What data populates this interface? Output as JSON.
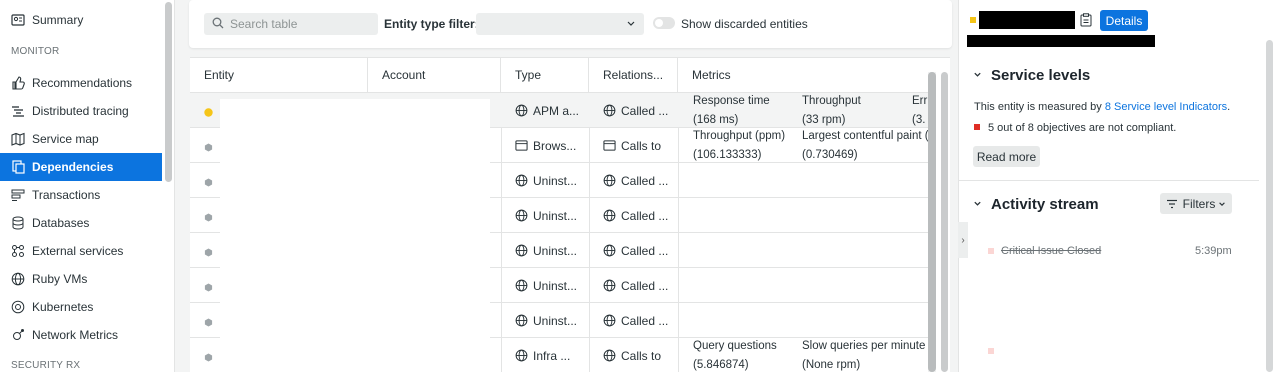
{
  "sidebar": {
    "top_item": {
      "label": "Summary",
      "icon": "summary-icon"
    },
    "sections": {
      "monitor": "MONITOR",
      "security": "SECURITY RX"
    },
    "items": [
      {
        "label": "Recommendations",
        "icon": "thumbs-up-icon"
      },
      {
        "label": "Distributed tracing",
        "icon": "tracing-icon"
      },
      {
        "label": "Service map",
        "icon": "map-icon"
      },
      {
        "label": "Dependencies",
        "icon": "dependencies-icon",
        "active": true
      },
      {
        "label": "Transactions",
        "icon": "transactions-icon"
      },
      {
        "label": "Databases",
        "icon": "database-icon"
      },
      {
        "label": "External services",
        "icon": "external-services-icon"
      },
      {
        "label": "Ruby VMs",
        "icon": "globe-icon"
      },
      {
        "label": "Kubernetes",
        "icon": "kubernetes-icon"
      },
      {
        "label": "Network Metrics",
        "icon": "network-icon"
      }
    ]
  },
  "toolbar": {
    "search_placeholder": "Search table",
    "filter_label": "Entity type filter:",
    "filter_value": "",
    "toggle_label": "Show discarded entities"
  },
  "table": {
    "columns": [
      "Entity",
      "Account",
      "Type",
      "Relations...",
      "Metrics"
    ],
    "rows": [
      {
        "status": "yellow",
        "type": "APM a...",
        "type_icon": "globe-icon",
        "relation": "Called ...",
        "relation_icon": "globe-icon",
        "metrics": [
          {
            "name": "Response time",
            "value": "(168 ms)"
          },
          {
            "name": "Throughput",
            "value": "(33 rpm)"
          },
          {
            "name": "Err",
            "value": "(3."
          }
        ]
      },
      {
        "status": "gray",
        "type": "Brows...",
        "type_icon": "browser-icon",
        "relation": "Calls to",
        "relation_icon": "browser-icon",
        "metrics": [
          {
            "name": "Throughput (ppm)",
            "value": "(106.133333)"
          },
          {
            "name": "Largest contentful paint (",
            "value": "(0.730469)"
          }
        ]
      },
      {
        "status": "gray",
        "type": "Uninst...",
        "type_icon": "globe-icon",
        "relation": "Called ...",
        "relation_icon": "globe-icon",
        "metrics": []
      },
      {
        "status": "gray",
        "type": "Uninst...",
        "type_icon": "globe-icon",
        "relation": "Called ...",
        "relation_icon": "globe-icon",
        "metrics": []
      },
      {
        "status": "gray",
        "type": "Uninst...",
        "type_icon": "globe-icon",
        "relation": "Called ...",
        "relation_icon": "globe-icon",
        "metrics": []
      },
      {
        "status": "gray",
        "type": "Uninst...",
        "type_icon": "globe-icon",
        "relation": "Called ...",
        "relation_icon": "globe-icon",
        "metrics": []
      },
      {
        "status": "gray",
        "type": "Uninst...",
        "type_icon": "globe-icon",
        "relation": "Called ...",
        "relation_icon": "globe-icon",
        "metrics": []
      },
      {
        "status": "gray",
        "type": "Infra ...",
        "type_icon": "globe-icon",
        "relation": "Calls to",
        "relation_icon": "globe-icon",
        "metrics": [
          {
            "name": "Query questions",
            "value": "(5.846874)"
          },
          {
            "name": "Slow queries per minute",
            "value": "(None rpm)"
          }
        ]
      }
    ]
  },
  "panel": {
    "details_label": "Details",
    "service_levels": {
      "title": "Service levels",
      "text_prefix": "This entity is measured by ",
      "link_text": "8 Service level Indicators",
      "text_suffix": ".",
      "status_text": "5 out of 8 objectives are not compliant.",
      "read_more": "Read more"
    },
    "activity": {
      "title": "Activity stream",
      "filters_label": "Filters",
      "items": [
        {
          "text": "Critical Issue Closed",
          "time": "5:39pm"
        }
      ]
    }
  },
  "colors": {
    "accent": "#0c74df",
    "status_yellow": "#f5c518",
    "status_gray": "#9ea5a9",
    "critical_red": "#df2d24"
  }
}
